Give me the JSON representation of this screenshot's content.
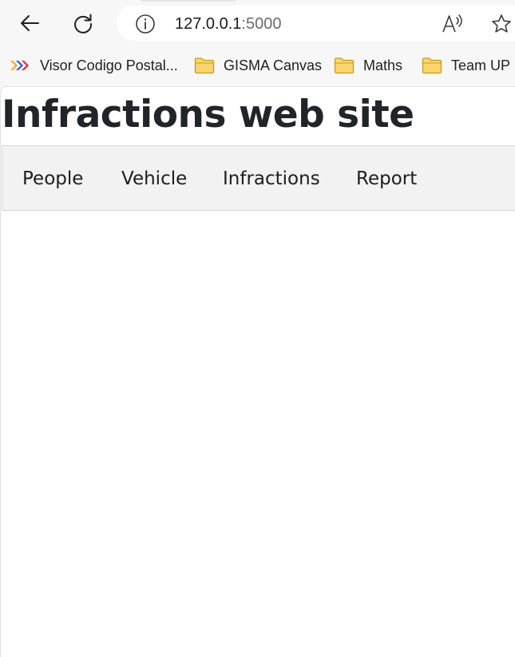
{
  "browser": {
    "address_bar": {
      "host": "127.0.0.1",
      "port": ":5000"
    },
    "bookmarks": [
      {
        "label": "Visor Codigo Postal...",
        "icon": "chevron-arrows-icon"
      },
      {
        "label": "GISMA Canvas",
        "icon": "folder-icon"
      },
      {
        "label": "Maths",
        "icon": "folder-icon"
      },
      {
        "label": "Team UP",
        "icon": "folder-icon"
      }
    ],
    "icons": {
      "back": "back-arrow-icon",
      "reload": "reload-icon",
      "site_info": "info-icon",
      "read_aloud": "read-aloud-icon",
      "favorite": "star-icon"
    }
  },
  "page": {
    "title": "Infractions web site",
    "nav": [
      {
        "label": "People"
      },
      {
        "label": "Vehicle"
      },
      {
        "label": "Infractions"
      },
      {
        "label": "Report"
      }
    ]
  },
  "colors": {
    "chrome_background": "#f7f7f7",
    "nav_background": "#f2f2f2",
    "title_text": "#212529",
    "folder_fill": "#f9d66d",
    "folder_stroke": "#c99a1f"
  }
}
